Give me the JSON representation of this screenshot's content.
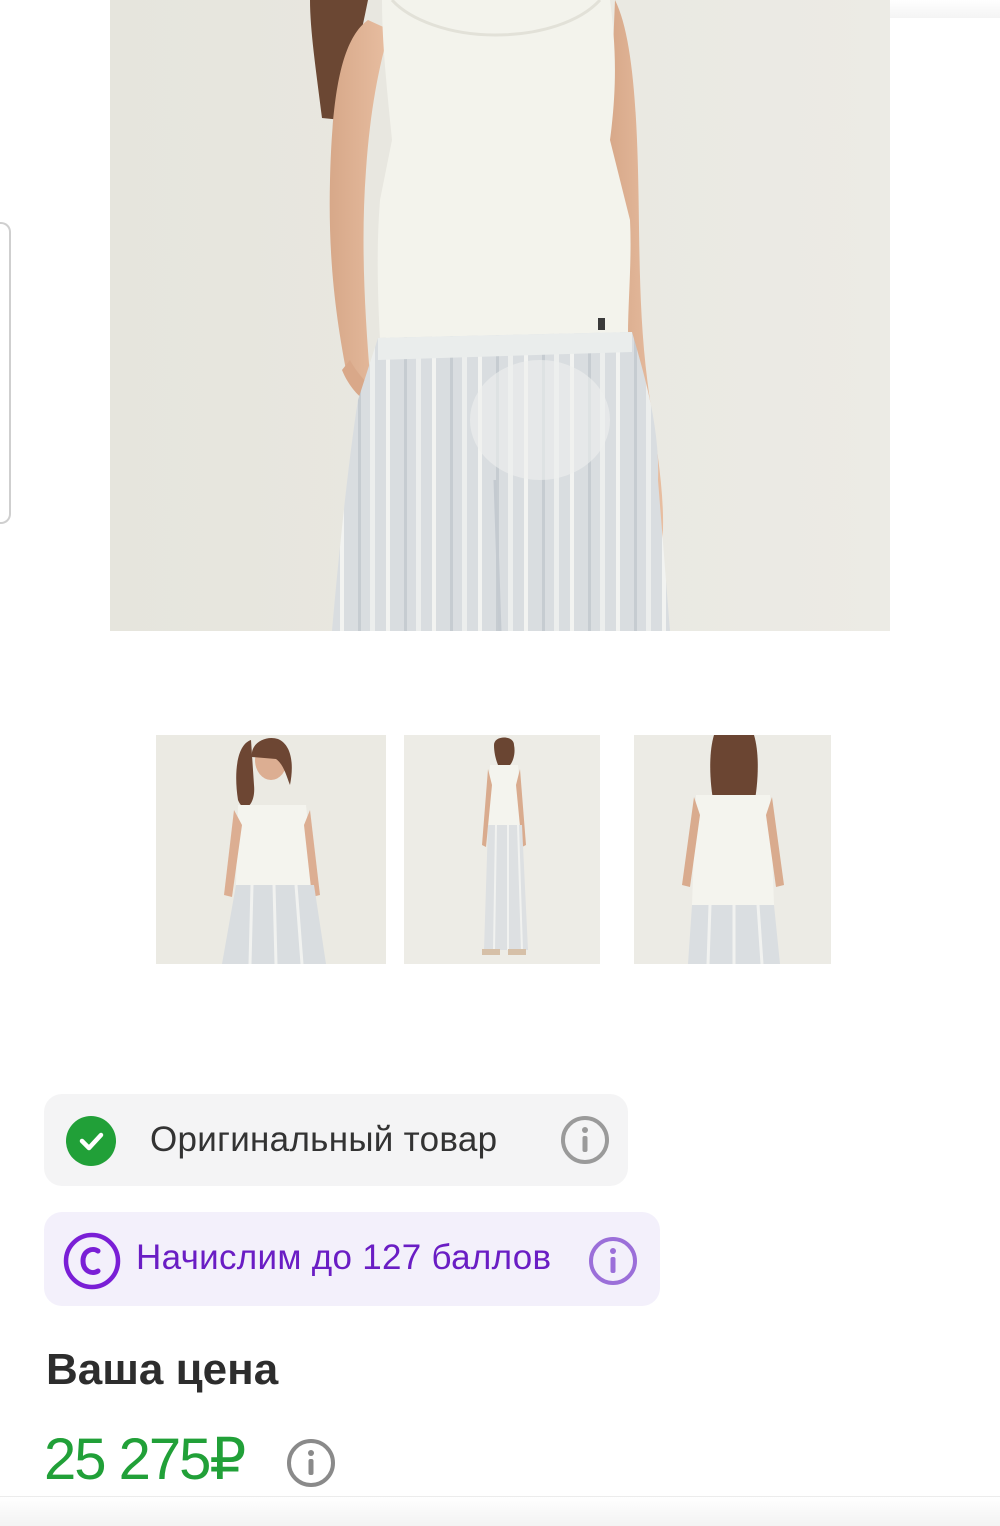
{
  "gallery": {
    "main_photo_alt": "product-photo-main",
    "thumbnails": [
      {
        "name": "thumbnail-front-closeup"
      },
      {
        "name": "thumbnail-full-length"
      },
      {
        "name": "thumbnail-back-view"
      }
    ]
  },
  "badges": {
    "original": {
      "label": "Оригинальный товар",
      "icon": "check-circle-icon",
      "info_icon": "info-icon",
      "color": "#21a038"
    },
    "bonus": {
      "label": "Начислим до 127 баллов",
      "icon": "bonus-coin-icon",
      "info_icon": "info-icon",
      "color": "#6a1dc4"
    }
  },
  "price": {
    "heading": "Ваша цена",
    "value": "25 275₽",
    "info_icon": "info-icon",
    "color": "#21a038"
  }
}
